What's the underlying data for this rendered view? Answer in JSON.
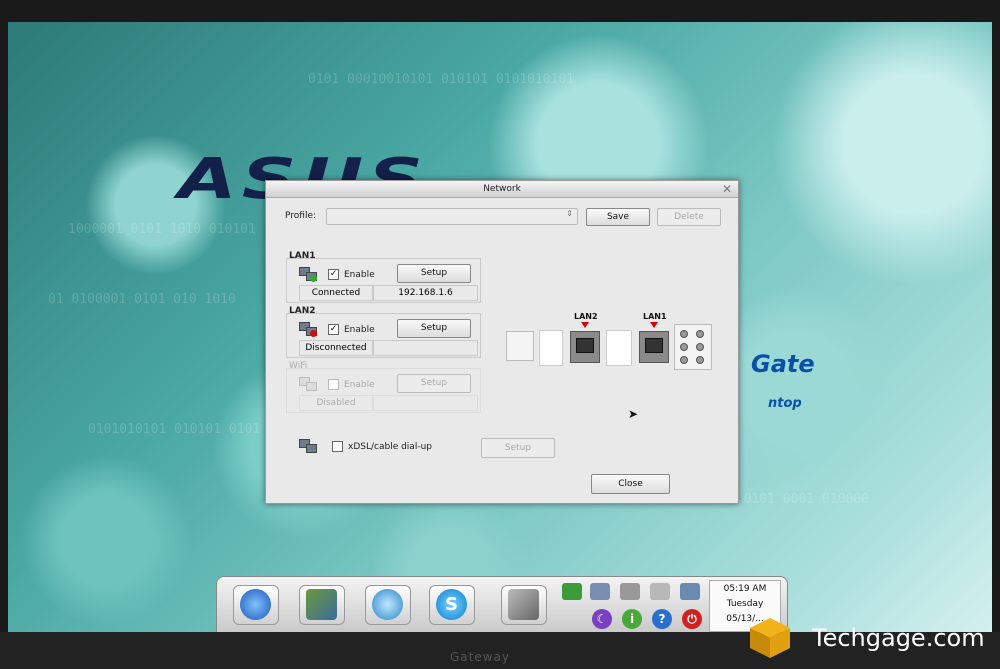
{
  "dialog": {
    "title": "Network",
    "profile_label": "Profile:",
    "profile_value": "",
    "save_label": "Save",
    "delete_label": "Delete",
    "close_label": "Close",
    "lan1": {
      "label": "LAN1",
      "enable_label": "Enable",
      "enabled": true,
      "setup_label": "Setup",
      "status": "Connected",
      "ip": "192.168.1.6"
    },
    "lan2": {
      "label": "LAN2",
      "enable_label": "Enable",
      "enabled": true,
      "setup_label": "Setup",
      "status": "Disconnected",
      "ip": ""
    },
    "wifi": {
      "label": "WiFi",
      "enable_label": "Enable",
      "enabled": false,
      "setup_label": "Setup",
      "status": "Disabled",
      "ip": ""
    },
    "xdsl": {
      "label": "xDSL/cable dial-up",
      "enabled": false,
      "setup_label": "Setup"
    },
    "panel": {
      "lan2_label": "LAN2",
      "lan1_label": "LAN1"
    }
  },
  "desktop": {
    "brand": "ASUS",
    "gate_text": "Gate",
    "top_text": "ntop"
  },
  "taskbar": {
    "time": "05:19 AM",
    "day": "Tuesday",
    "date": "05/13/..."
  },
  "watermark": "Techgage.com",
  "bezel_label": "Gateway",
  "colors": {
    "lan_ok": "#2fae2f",
    "lan_err": "#d01010",
    "arrow": "#dd0000"
  }
}
